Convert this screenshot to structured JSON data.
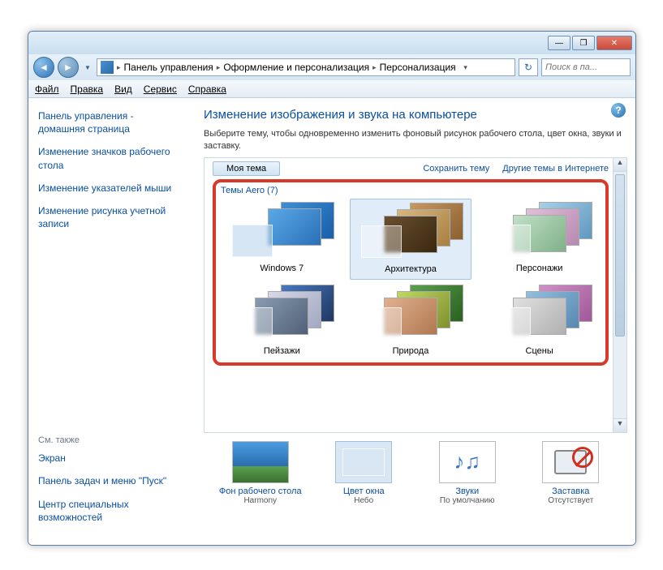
{
  "titlebar": {
    "minimize": "—",
    "maximize": "❐",
    "close": "✕"
  },
  "nav": {
    "back": "◄",
    "forward": "►",
    "dropdown": "▼",
    "refresh": "↻",
    "search_placeholder": "Поиск в па..."
  },
  "breadcrumb": {
    "root": "Панель управления",
    "mid": "Оформление и персонализация",
    "leaf": "Персонализация",
    "sep": "▸"
  },
  "menu": {
    "file": "Файл",
    "edit": "Правка",
    "view": "Вид",
    "tools": "Сервис",
    "help": "Справка"
  },
  "sidebar": {
    "links": [
      "Панель управления - домашняя страница",
      "Изменение значков рабочего стола",
      "Изменение указателей мыши",
      "Изменение рисунка учетной записи"
    ],
    "see_also_title": "См. также",
    "see_also": [
      "Экран",
      "Панель задач и меню \"Пуск\"",
      "Центр специальных возможностей"
    ]
  },
  "content": {
    "title": "Изменение изображения и звука на компьютере",
    "desc": "Выберите тему, чтобы одновременно изменить фоновый рисунок рабочего стола, цвет окна, звуки и заставку.",
    "my_theme_btn": "Моя тема",
    "save_theme": "Сохранить тему",
    "other_themes": "Другие темы в Интернете",
    "aero_group": "Темы Aero (7)",
    "themes": [
      {
        "name": "Windows 7",
        "cls": "th-win7",
        "stacks": 2
      },
      {
        "name": "Архитектура",
        "cls": "th-arch",
        "stacks": 3,
        "selected": true
      },
      {
        "name": "Персонажи",
        "cls": "th-char",
        "stacks": 3
      },
      {
        "name": "Пейзажи",
        "cls": "th-land",
        "stacks": 3
      },
      {
        "name": "Природа",
        "cls": "th-nat",
        "stacks": 3
      },
      {
        "name": "Сцены",
        "cls": "th-scen",
        "stacks": 3
      }
    ]
  },
  "bottom": {
    "items": [
      {
        "label": "Фон рабочего стола",
        "value": "Harmony",
        "name": "desktop-background",
        "thumb": "bg"
      },
      {
        "label": "Цвет окна",
        "value": "Небо",
        "name": "window-color",
        "thumb": "wc"
      },
      {
        "label": "Звуки",
        "value": "По умолчанию",
        "name": "sounds",
        "thumb": "snd"
      },
      {
        "label": "Заставка",
        "value": "Отсутствует",
        "name": "screensaver",
        "thumb": "ss"
      }
    ]
  }
}
